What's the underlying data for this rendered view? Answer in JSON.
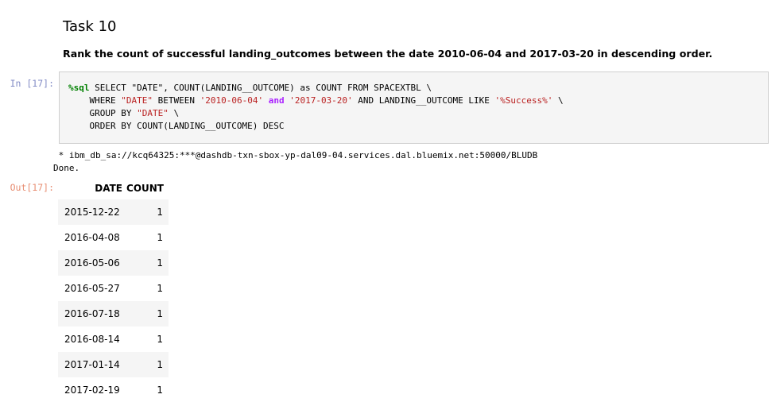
{
  "markdown": {
    "heading": "Task 10",
    "paragraph": "Rank the count of successful landing_outcomes between the date 2010-06-04 and 2017-03-20 in descending order."
  },
  "code_cell": {
    "in_prompt": "In [17]:",
    "line1_magic": "%sql",
    "line1_rest": " SELECT \"DATE\", COUNT(LANDING__OUTCOME) as COUNT FROM SPACEXTBL \\",
    "line2_a": "    WHERE ",
    "line2_date_col": "\"DATE\"",
    "line2_b": " BETWEEN ",
    "line2_date1": "'2010-06-04'",
    "line2_and": "and",
    "line2_date2": "'2017-03-20'",
    "line2_c": " AND LANDING__OUTCOME LIKE ",
    "line2_pattern": "'%Success%'",
    "line2_d": " \\",
    "line3_a": "    GROUP BY ",
    "line3_col": "\"DATE\"",
    "line3_b": " \\",
    "line4": "    ORDER BY COUNT(LANDING__OUTCOME) DESC"
  },
  "stdout": {
    "line1": " * ibm_db_sa://kcq64325:***@dashdb-txn-sbox-yp-dal09-04.services.dal.bluemix.net:50000/BLUDB",
    "line2": "Done."
  },
  "output": {
    "out_prompt": "Out[17]:",
    "columns": [
      "DATE",
      "COUNT"
    ],
    "rows": [
      [
        "2015-12-22",
        "1"
      ],
      [
        "2016-04-08",
        "1"
      ],
      [
        "2016-05-06",
        "1"
      ],
      [
        "2016-05-27",
        "1"
      ],
      [
        "2016-07-18",
        "1"
      ],
      [
        "2016-08-14",
        "1"
      ],
      [
        "2017-01-14",
        "1"
      ],
      [
        "2017-02-19",
        "1"
      ]
    ]
  },
  "colors": {
    "magic": "#008000",
    "string": "#ba2121",
    "keyword": "#aa22ff",
    "in_prompt": "#303f9f",
    "out_prompt": "#d84315"
  }
}
